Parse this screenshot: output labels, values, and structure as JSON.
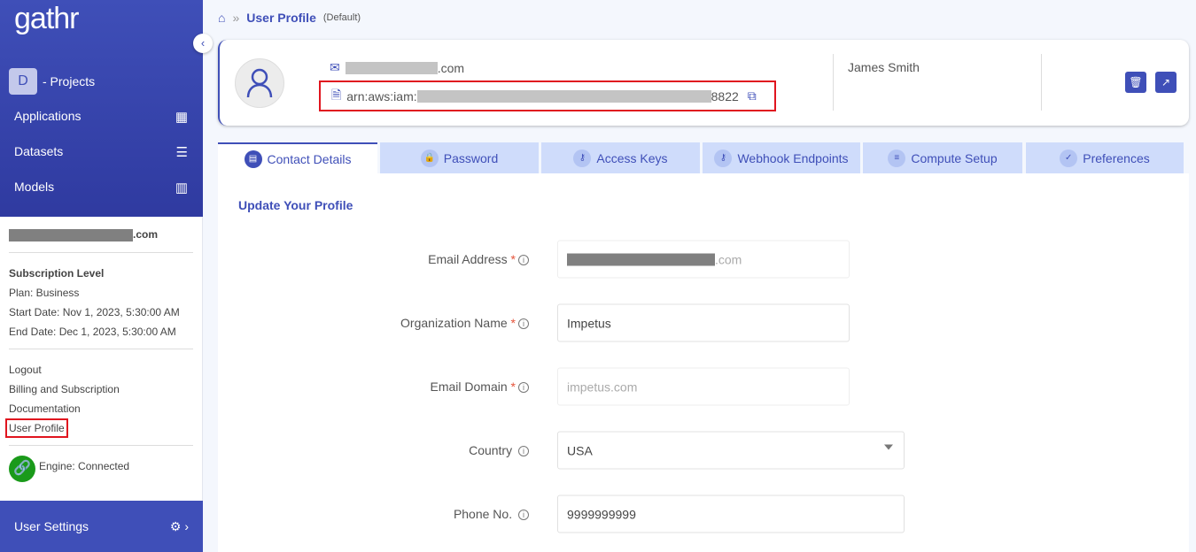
{
  "sidebar": {
    "logo": "gathr",
    "project_initial": "D",
    "project_label": "- Projects",
    "nav": [
      {
        "label": "Applications",
        "icon": "grid-icon"
      },
      {
        "label": "Datasets",
        "icon": "database-icon"
      },
      {
        "label": "Models",
        "icon": "bar-chart-icon"
      }
    ],
    "email_suffix": ".com",
    "subscription_title": "Subscription Level",
    "plan": "Plan: Business",
    "start_date": "Start Date: Nov 1, 2023, 5:30:00 AM",
    "end_date": "End Date: Dec 1, 2023, 5:30:00 AM",
    "links": [
      "Logout",
      "Billing and Subscription",
      "Documentation",
      "User Profile"
    ],
    "engine_status": "Engine: Connected",
    "user_settings": "User Settings"
  },
  "breadcrumb": {
    "title": "User Profile",
    "subtitle": "(Default)"
  },
  "profile_card": {
    "email_suffix": ".com",
    "arn_prefix": "arn:aws:iam:",
    "arn_suffix": "8822",
    "name": "James Smith"
  },
  "tabs": [
    "Contact Details",
    "Password",
    "Access Keys",
    "Webhook Endpoints",
    "Compute Setup",
    "Preferences"
  ],
  "form": {
    "title": "Update Your Profile",
    "fields": [
      {
        "label": "Email Address",
        "required": "*",
        "value_suffix": ".com"
      },
      {
        "label": "Organization Name",
        "required": "*",
        "value": "Impetus"
      },
      {
        "label": "Email Domain",
        "required": "*",
        "value": "impetus.com"
      },
      {
        "label": "Country",
        "value": "USA"
      },
      {
        "label": "Phone No.",
        "value": "9999999999"
      }
    ]
  },
  "colors": {
    "primary": "#3f4fb8",
    "highlight": "#e0151f",
    "connected": "#1a9a1a",
    "tab_bg": "#cfdcfb"
  }
}
